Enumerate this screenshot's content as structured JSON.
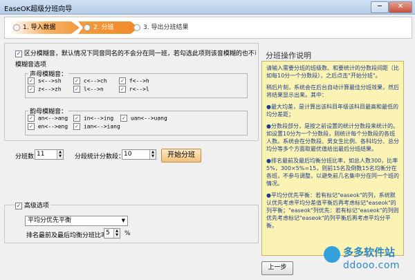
{
  "window": {
    "title": "EaseOK超级分班向导",
    "min": "─",
    "close": "✕"
  },
  "steps": [
    {
      "num": "1.",
      "label": "导入数据"
    },
    {
      "num": "2.",
      "label": "分班"
    },
    {
      "num": "3.",
      "label": "导出分班结果"
    }
  ],
  "fuzzy": {
    "main_label": "区分模糊音，默认情况下同音同名的不会分在同一班，若勾选此项则该音模糊的也不可分在同班",
    "options_label": "模糊音选项",
    "initials_label": "声母模糊音：",
    "initials": [
      "s<-->sh",
      "c<-->ch",
      "f<-->h",
      "z<-->zh",
      "l<-->n",
      "r<-->l"
    ],
    "finals_label": "韵母模糊音：",
    "finals": [
      "an<-->ang",
      "in<-->ing",
      "uan<-->uang",
      "en<-->eng",
      "ian<-->iang"
    ]
  },
  "classes": {
    "label": "分班数：",
    "value": "11"
  },
  "segments": {
    "label": "分段统计分数段：",
    "value": "10"
  },
  "start_button": "开始分班",
  "advanced": {
    "label": "高级选项",
    "select_value": "平均分优先平衡",
    "ratio_label": "排名最前及最后均衡分班比率：",
    "ratio_value": "5",
    "ratio_unit": "%"
  },
  "help": {
    "title": "分班操作说明",
    "paragraphs": [
      "请输入需要分班的班级数、和要统计的分数段间距（比如每10分一个分数段），之后点击\"开始分班\"。",
      "稍后片刻，系统会在后台自动计算最佳分班效果，然后将结果显示出来。其中：",
      "●最大均差，是计算出该科目年级该科目最高和最低的均分差距；",
      "●分数段部分，是按之前设置的统计分数段来统计的。如设置10分为一个分数段，则统计每个分数段的各班人数。系统会在分数段、男女生比例、各科均分、总分均分等多个方面取最优值给出最后分班结果。",
      "●排名最前及最后均衡分班比率，如总人数300，比率5%，300×5%=15，则前15名及倒数15名均衡分在各班，不参与调整，以避免前几名集中分在同一个班的情况。",
      "●平均分优先平衡：若有标记\"easeok\"的列，系统默认优先考虑平均分差值平衡后再考虑标记\"easeok\"的列平衡；\"easeok\"列优先：若有标记\"easeok\"的列则优先考虑标记\"easeok\"的列平衡后再考虑平均分平衡。"
    ]
  },
  "prev_button": "上一步",
  "watermark": {
    "text": "多多软件站",
    "url": "ddooo.com"
  }
}
